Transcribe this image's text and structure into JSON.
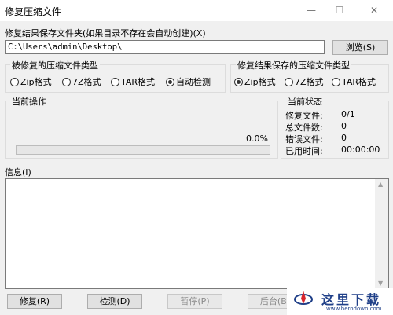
{
  "window": {
    "title": "修复压缩文件",
    "minimize_glyph": "—",
    "maximize_glyph": "☐",
    "close_glyph": "✕"
  },
  "output_folder": {
    "label": "修复结果保存文件夹(如果目录不存在会自动创建)(X)",
    "value": "C:\\Users\\admin\\Desktop\\",
    "browse_label": "浏览(S)"
  },
  "source_type": {
    "title": "被修复的压缩文件类型",
    "options": [
      "Zip格式",
      "7Z格式",
      "TAR格式",
      "自动检测"
    ],
    "selected": "自动检测"
  },
  "result_type": {
    "title": "修复结果保存的压缩文件类型",
    "options": [
      "Zip格式",
      "7Z格式",
      "TAR格式"
    ],
    "selected": "Zip格式"
  },
  "current_operation": {
    "title": "当前操作",
    "percent_text": "0.0%",
    "progress": 0.0
  },
  "current_status": {
    "title": "当前状态",
    "rows": [
      {
        "label": "修复文件:",
        "value": "0/1"
      },
      {
        "label": "总文件数:",
        "value": "0"
      },
      {
        "label": "错误文件:",
        "value": "0"
      },
      {
        "label": "已用时间:",
        "value": "00:00:00"
      }
    ]
  },
  "info": {
    "label": "信息(I)"
  },
  "buttons": {
    "repair": "修复(R)",
    "detect": "检测(D)",
    "pause": "暂停(P)",
    "background": "后台(B)"
  },
  "watermark": {
    "text": "这里下载",
    "url": "www.herodown.com"
  },
  "colors": {
    "window_bg": "#f0f0f0",
    "progress_fill": "#06b025",
    "watermark_blue": "#1f3f88",
    "watermark_red": "#d8262e"
  }
}
